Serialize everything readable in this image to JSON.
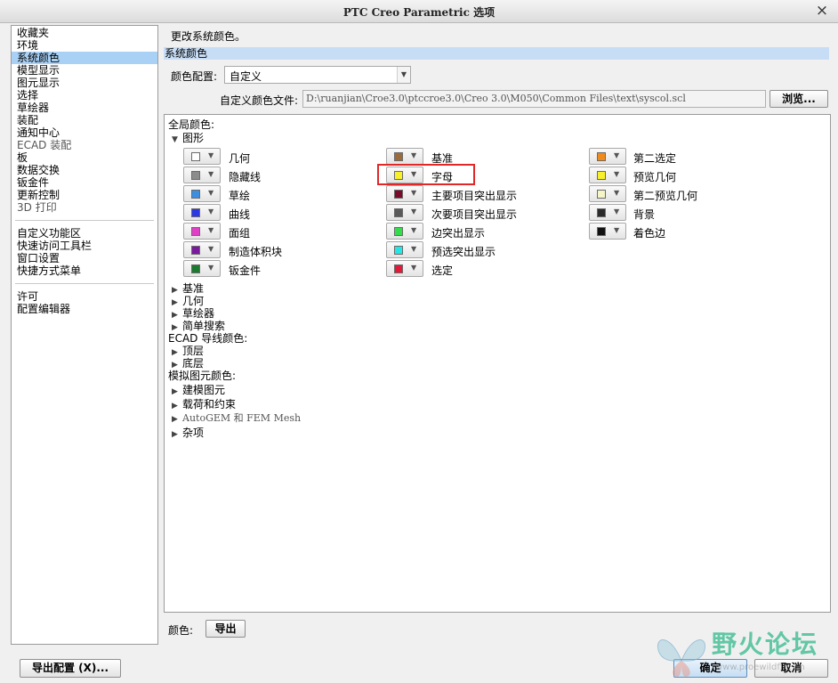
{
  "window": {
    "title": "PTC Creo Parametric 选项",
    "close_glyph": "×"
  },
  "nav": {
    "group1": [
      "收藏夹",
      "环境",
      "系统颜色",
      "模型显示",
      "图元显示",
      "选择",
      "草绘器",
      "装配",
      "通知中心",
      "ECAD 装配",
      "板",
      "数据交换",
      "钣金件",
      "更新控制",
      "3D 打印"
    ],
    "group2": [
      "自定义功能区",
      "快速访问工具栏",
      "窗口设置",
      "快捷方式菜单"
    ],
    "group3": [
      "许可",
      "配置编辑器"
    ],
    "selected": "系统颜色"
  },
  "main": {
    "description": "更改系统颜色。",
    "section_title": "系统颜色",
    "color_config_label": "颜色配置:",
    "color_config_value": "自定义",
    "custom_file_label": "自定义颜色文件:",
    "custom_file_path": "D:\\ruanjian\\Croe3.0\\ptccroe3.0\\Creo 3.0\\M050\\Common Files\\text\\syscol.scl",
    "browse_label": "浏览..."
  },
  "panel": {
    "global_colors": "全局颜色:",
    "graphics_group": "图形",
    "columns": [
      [
        {
          "label": "几何",
          "color": "#ffffff"
        },
        {
          "label": "隐藏线",
          "color": "#8c8c8c"
        },
        {
          "label": "草绘",
          "color": "#3a8fe0"
        },
        {
          "label": "曲线",
          "color": "#2b38e3"
        },
        {
          "label": "面组",
          "color": "#e040c8"
        },
        {
          "label": "制造体积块",
          "color": "#7a1a9e"
        },
        {
          "label": "钣金件",
          "color": "#1c7a30"
        }
      ],
      [
        {
          "label": "基准",
          "color": "#9c6b3c"
        },
        {
          "label": "字母",
          "color": "#f7f02a"
        },
        {
          "label": "主要项目突出显示",
          "color": "#7a0a2a"
        },
        {
          "label": "次要项目突出显示",
          "color": "#5a5a5a"
        },
        {
          "label": "边突出显示",
          "color": "#33dd4a"
        },
        {
          "label": "预选突出显示",
          "color": "#27e5e5"
        },
        {
          "label": "选定",
          "color": "#e21a3a"
        }
      ],
      [
        {
          "label": "第二选定",
          "color": "#f08a1a"
        },
        {
          "label": "预览几何",
          "color": "#f7f02a"
        },
        {
          "label": "第二预览几何",
          "color": "#f5f5c8"
        },
        {
          "label": "背景",
          "color": "#2a2a2a"
        },
        {
          "label": "着色边",
          "color": "#111111"
        }
      ]
    ],
    "collapsed_groups": [
      "基准",
      "几何",
      "草绘器",
      "简单搜索"
    ],
    "ecad_label": "ECAD 导线颜色:",
    "ecad_groups": [
      "顶层",
      "底层"
    ],
    "sim_label": "模拟图元颜色:",
    "sim_groups": [
      "建模图元",
      "载荷和约束",
      "AutoGEM 和 FEM Mesh",
      "杂项"
    ]
  },
  "footer": {
    "color_label": "颜色:",
    "export_label": "导出",
    "export_config_label": "导出配置 (X)...",
    "ok_label": "确定",
    "cancel_label": "取消"
  },
  "watermark": {
    "text": "野火论坛",
    "url": "www.proewildfire.cn"
  }
}
